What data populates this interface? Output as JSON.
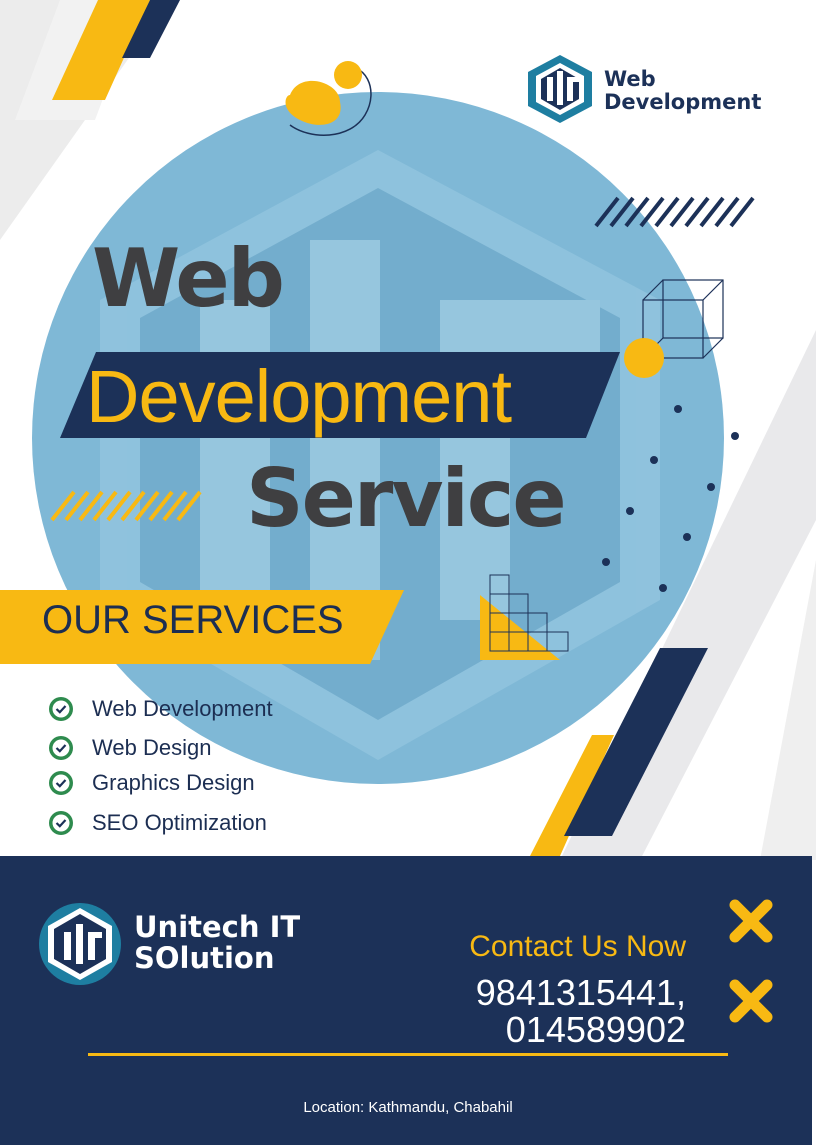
{
  "top_logo": {
    "line1": "Web",
    "line2": "Development"
  },
  "headline": {
    "line1": "Web",
    "line2": "Development",
    "line3": "Service"
  },
  "services": {
    "title": "OUR SERVICES",
    "items": [
      "Web Development",
      "Web Design",
      "Graphics Design",
      "SEO Optimization"
    ]
  },
  "brand": {
    "line1": "Unitech IT",
    "line2": "SOlution"
  },
  "contact": {
    "title": "Contact Us Now",
    "phone1": "9841315441,",
    "phone2": "014589902"
  },
  "location": "Location: Kathmandu, Chabahil",
  "colors": {
    "navy": "#1c3158",
    "yellow": "#f8b913",
    "circle": "#7fb8d6",
    "teal": "#1e7ea1",
    "gray_text": "#3f3f41"
  },
  "icons": [
    "check-circle-icon",
    "close-x-icon",
    "hexagon-ut-logo"
  ]
}
